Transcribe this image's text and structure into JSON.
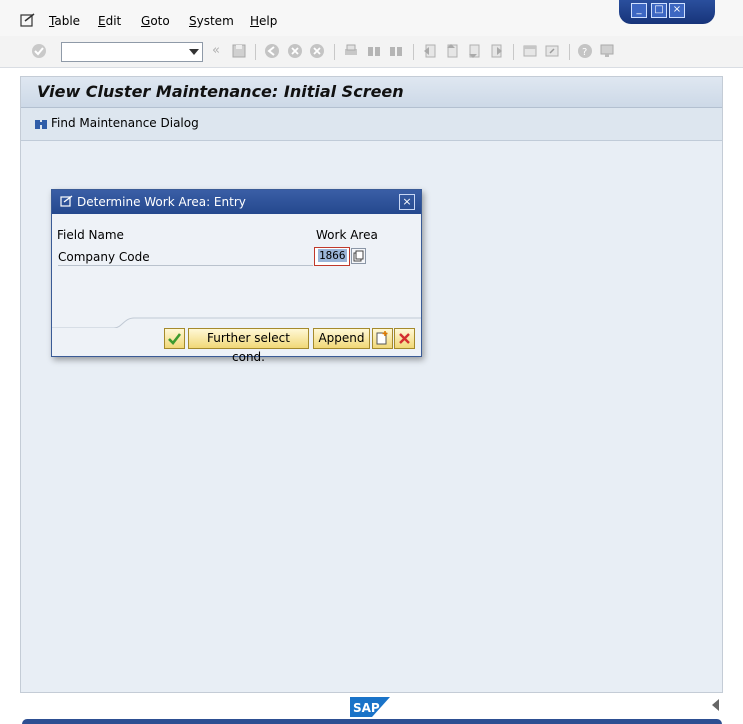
{
  "menubar": {
    "items": [
      {
        "label": "Table",
        "u": "T",
        "rest": "able"
      },
      {
        "label": "Edit",
        "u": "E",
        "rest": "dit"
      },
      {
        "label": "Goto",
        "u": "G",
        "rest": "oto"
      },
      {
        "label": "System",
        "u": "S",
        "rest": "ystem"
      },
      {
        "label": "Help",
        "u": "H",
        "rest": "elp"
      }
    ]
  },
  "toolbar": {
    "command_value": ""
  },
  "screen": {
    "title": "View Cluster Maintenance: Initial Screen",
    "app_toolbar": {
      "find_label": "Find Maintenance Dialog"
    }
  },
  "dialog": {
    "title": "Determine Work Area: Entry",
    "col_field_name": "Field Name",
    "col_work_area": "Work Area",
    "row_label": "Company Code",
    "work_area_value": "1866",
    "btn_further": "Further select cond.",
    "btn_append": "Append"
  },
  "footer": {
    "logo_text": "SAP"
  },
  "colors": {
    "title_bar": "#24488e",
    "screen_bg": "#e8eef5",
    "button_yellow": "#f1d878",
    "cancel_red": "#d32f2f",
    "confirm_green": "#4caf50"
  }
}
